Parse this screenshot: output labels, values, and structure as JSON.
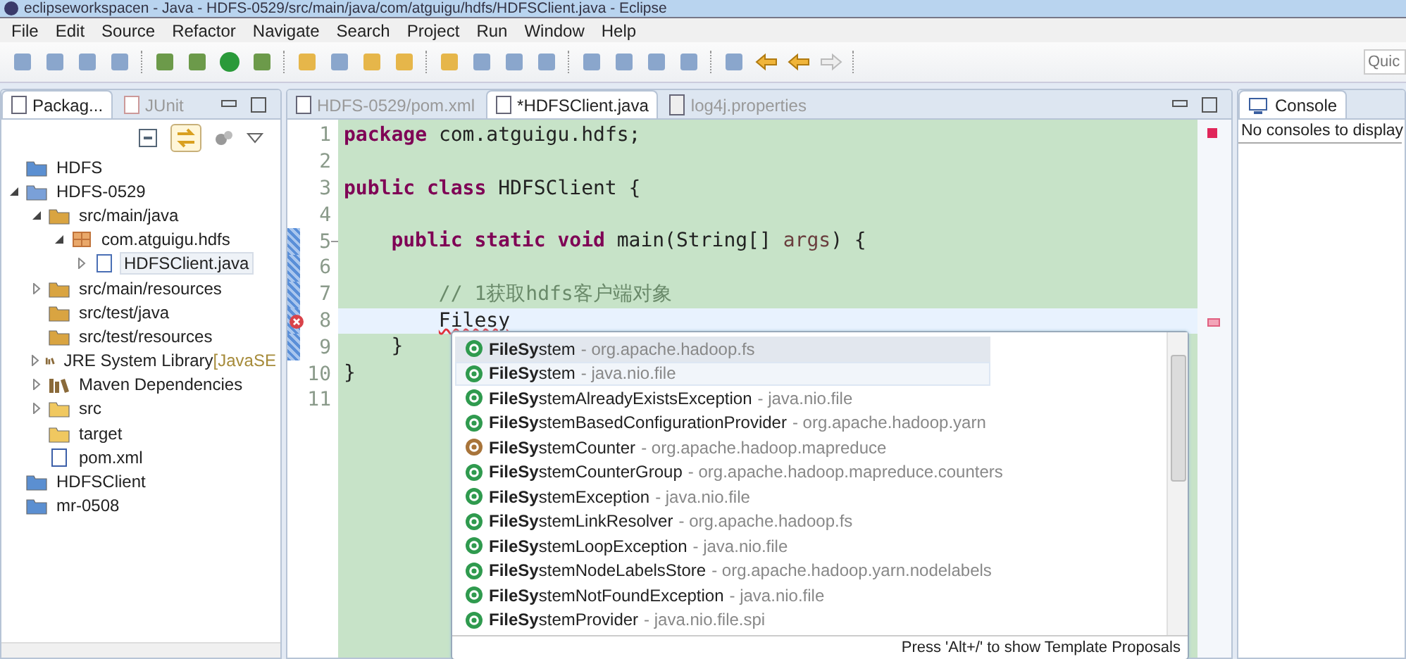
{
  "window": {
    "title": "eclipseworkspacen - Java - HDFS-0529/src/main/java/com/atguigu/hdfs/HDFSClient.java - Eclipse"
  },
  "menu": [
    "File",
    "Edit",
    "Source",
    "Refactor",
    "Navigate",
    "Search",
    "Project",
    "Run",
    "Window",
    "Help"
  ],
  "quick_access": {
    "placeholder": "Quic"
  },
  "explorer": {
    "tabs": [
      {
        "label": "Packag...",
        "selected": true,
        "kind": "package"
      },
      {
        "label": "JUnit",
        "selected": false,
        "kind": "junit"
      }
    ],
    "tree": [
      {
        "label": "HDFS",
        "kind": "project",
        "selected": false
      },
      {
        "label": "HDFS-0529",
        "kind": "maven",
        "expanded": true,
        "selected": false,
        "children": [
          {
            "label": "src/main/java",
            "kind": "srcfolder",
            "expanded": true,
            "selected": false,
            "children": [
              {
                "label": "com.atguigu.hdfs",
                "kind": "package",
                "expanded": true,
                "selected": false,
                "children": [
                  {
                    "label": "HDFSClient.java",
                    "kind": "java",
                    "expanded": false,
                    "selected": true
                  }
                ]
              }
            ]
          },
          {
            "label": "src/main/resources",
            "kind": "srcfolder",
            "expanded": false,
            "selected": false
          },
          {
            "label": "src/test/java",
            "kind": "srcfolder",
            "selected": false
          },
          {
            "label": "src/test/resources",
            "kind": "srcfolder",
            "selected": false
          },
          {
            "label": "JRE System Library",
            "suffix": "[JavaSE",
            "kind": "library",
            "expanded": false,
            "selected": false
          },
          {
            "label": "Maven Dependencies",
            "kind": "library",
            "expanded": false,
            "selected": false
          },
          {
            "label": "src",
            "kind": "folder",
            "expanded": false,
            "selected": false
          },
          {
            "label": "target",
            "kind": "folder",
            "selected": false
          },
          {
            "label": "pom.xml",
            "kind": "xml",
            "selected": false
          }
        ]
      },
      {
        "label": "HDFSClient",
        "kind": "project",
        "selected": false
      },
      {
        "label": "mr-0508",
        "kind": "project",
        "selected": false
      }
    ]
  },
  "editor": {
    "tabs": [
      {
        "label": "HDFS-0529/pom.xml",
        "selected": false,
        "kind": "xml"
      },
      {
        "label": "*HDFSClient.java",
        "selected": true,
        "kind": "java"
      },
      {
        "label": "log4j.properties",
        "selected": false,
        "kind": "text"
      }
    ],
    "lines": [
      {
        "number": "1",
        "tokens": [
          {
            "kind": "keyword",
            "text": "package"
          },
          {
            "kind": "plain",
            "text": " com.atguigu.hdfs;"
          }
        ]
      },
      {
        "number": "2"
      },
      {
        "number": "3",
        "tokens": [
          {
            "kind": "keyword",
            "text": "public class"
          },
          {
            "kind": "plain",
            "text": " HDFSClient {"
          }
        ]
      },
      {
        "number": "4"
      },
      {
        "number": "5",
        "changed": true,
        "fold": true,
        "tokens": [
          {
            "kind": "keyword",
            "text": "    public static void"
          },
          {
            "kind": "plain",
            "text": " main(String[] "
          },
          {
            "kind": "param",
            "text": "args"
          },
          {
            "kind": "plain",
            "text": ") {"
          }
        ]
      },
      {
        "number": "6",
        "changed": true
      },
      {
        "number": "7",
        "changed": true,
        "tokens": [
          {
            "kind": "comment",
            "text": "        // 1获取hdfs客户端对象"
          }
        ]
      },
      {
        "number": "8",
        "changed": true,
        "current": true,
        "error": true,
        "tokens": [
          {
            "kind": "error",
            "text": "        Filesy"
          }
        ]
      },
      {
        "number": "9",
        "changed": true,
        "tokens": [
          {
            "kind": "plain",
            "text": "    }"
          }
        ]
      },
      {
        "number": "10",
        "tokens": [
          {
            "kind": "plain",
            "text": "}"
          }
        ]
      },
      {
        "number": "11"
      }
    ],
    "proposals": [
      {
        "name": "**FileSy**stem",
        "detail": "- org.apache.hadoop.fs",
        "kind": "class",
        "selected": true,
        "hovered": false
      },
      {
        "name": "**FileSy**stem",
        "detail": "- java.nio.file",
        "kind": "class",
        "selected": false,
        "hovered": true
      },
      {
        "name": "**FileSy**stemAlreadyExistsException",
        "detail": "- java.nio.file",
        "kind": "class",
        "selected": false,
        "hovered": false
      },
      {
        "name": "**FileSy**stemBasedConfigurationProvider",
        "detail": "- org.apache.hadoop.yarn",
        "kind": "class",
        "selected": false,
        "hovered": false
      },
      {
        "name": "**FileSy**stemCounter",
        "detail": "- org.apache.hadoop.mapreduce",
        "kind": "enum",
        "selected": false,
        "hovered": false
      },
      {
        "name": "**FileSy**stemCounterGroup",
        "detail": "- org.apache.hadoop.mapreduce.counters",
        "kind": "class",
        "selected": false,
        "hovered": false
      },
      {
        "name": "**FileSy**stemException",
        "detail": "- java.nio.file",
        "kind": "class",
        "selected": false,
        "hovered": false
      },
      {
        "name": "**FileSy**stemLinkResolver",
        "detail": "- org.apache.hadoop.fs",
        "kind": "class",
        "selected": false,
        "hovered": false
      },
      {
        "name": "**FileSy**stemLoopException",
        "detail": "- java.nio.file",
        "kind": "class",
        "selected": false,
        "hovered": false
      },
      {
        "name": "**FileSy**stemNodeLabelsStore",
        "detail": "- org.apache.hadoop.yarn.nodelabels",
        "kind": "class",
        "selected": false,
        "hovered": false
      },
      {
        "name": "**FileSy**stemNotFoundException",
        "detail": "- java.nio.file",
        "kind": "class",
        "selected": false,
        "hovered": false
      },
      {
        "name": "**FileSy**stemProvider",
        "detail": "- java.nio.file.spi",
        "kind": "class",
        "selected": false,
        "hovered": false
      }
    ],
    "proposal_hint": "Press 'Alt+/' to show Template Proposals"
  },
  "console": {
    "tab": "Console",
    "message": "No consoles to display"
  }
}
